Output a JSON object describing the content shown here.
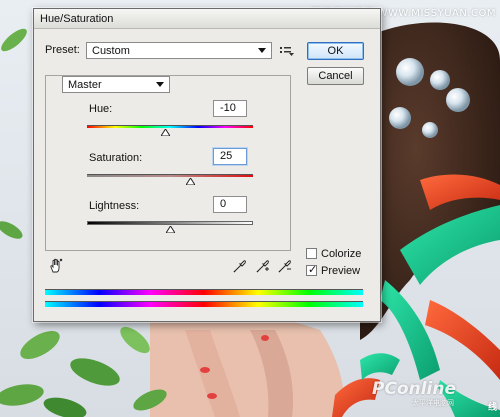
{
  "dialog": {
    "title": "Hue/Saturation",
    "preset_label": "Preset:",
    "preset_value": "Custom",
    "ok_label": "OK",
    "cancel_label": "Cancel"
  },
  "channel": {
    "value": "Master"
  },
  "adjust": {
    "hue_label": "Hue:",
    "hue_value": "-10",
    "saturation_label": "Saturation:",
    "saturation_value": "25",
    "lightness_label": "Lightness:",
    "lightness_value": "0"
  },
  "sliders": {
    "hue": {
      "value": -10,
      "min": -180,
      "max": 180
    },
    "saturation": {
      "value": 25,
      "min": -100,
      "max": 100
    },
    "lightness": {
      "value": 0,
      "min": -100,
      "max": 100
    }
  },
  "options": {
    "colorize_label": "Colorize",
    "colorize_checked": false,
    "preview_label": "Preview",
    "preview_checked": true
  },
  "watermarks": {
    "top_right": "思缘设计论坛 WWW.MISSYUAN.COM",
    "bottom_brand": "PConline",
    "bottom_sub": "太平洋电脑网",
    "corner": "线"
  },
  "colors": {
    "dialog_bg": "#ecebe7",
    "ok_border": "#2e6fbf"
  },
  "icons": {
    "preset_menu": "preset-options-icon",
    "hand_tool": "targeted-adjustment-hand-icon",
    "eyedropper": "eyedropper-icon",
    "eyedropper_plus": "eyedropper-plus-icon",
    "eyedropper_minus": "eyedropper-minus-icon"
  }
}
